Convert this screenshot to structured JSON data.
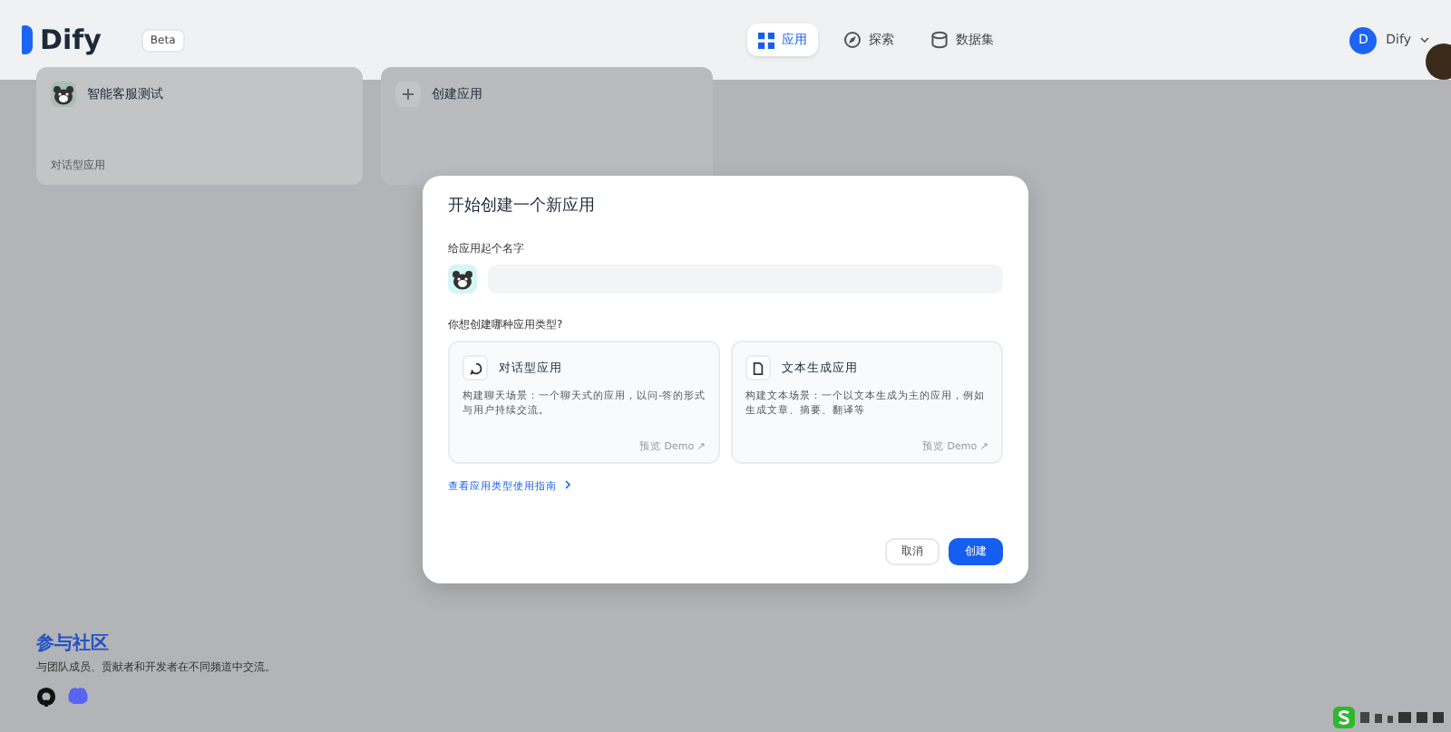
{
  "header": {
    "logo": "Dify",
    "badge": "Beta",
    "nav": [
      {
        "label": "应用",
        "selected": true,
        "kind": "apps"
      },
      {
        "label": "探索",
        "selected": false,
        "kind": "explore"
      },
      {
        "label": "数据集",
        "selected": false,
        "kind": "datasets"
      }
    ],
    "user": {
      "initial": "D",
      "name": "Dify"
    }
  },
  "apps": [
    {
      "name": "智能客服测试",
      "meta": "对话型应用"
    }
  ],
  "create_card": {
    "label": "创建应用"
  },
  "modal": {
    "title": "开始创建一个新应用",
    "name_label": "给应用起个名字",
    "type_label": "你想创建哪种应用类型?",
    "types": [
      {
        "kind": "chat",
        "title": "对话型应用",
        "description": "构建聊天场景：一个聊天式的应用，以问-答的形式与用户持续交流。",
        "preview": "预览 Demo ↗",
        "selected": false
      },
      {
        "kind": "text",
        "title": "文本生成应用",
        "description": "构建文本场景：一个以文本生成为主的应用，例如生成文章、摘要、翻译等",
        "preview": "预览 Demo ↗",
        "selected": false
      }
    ],
    "guide_link": "查看应用类型使用指南",
    "cancel": "取消",
    "create": "创建"
  },
  "community": {
    "title": "参与社区",
    "text": "与团队成员、贡献者和开发者在不同频道中交流。"
  }
}
